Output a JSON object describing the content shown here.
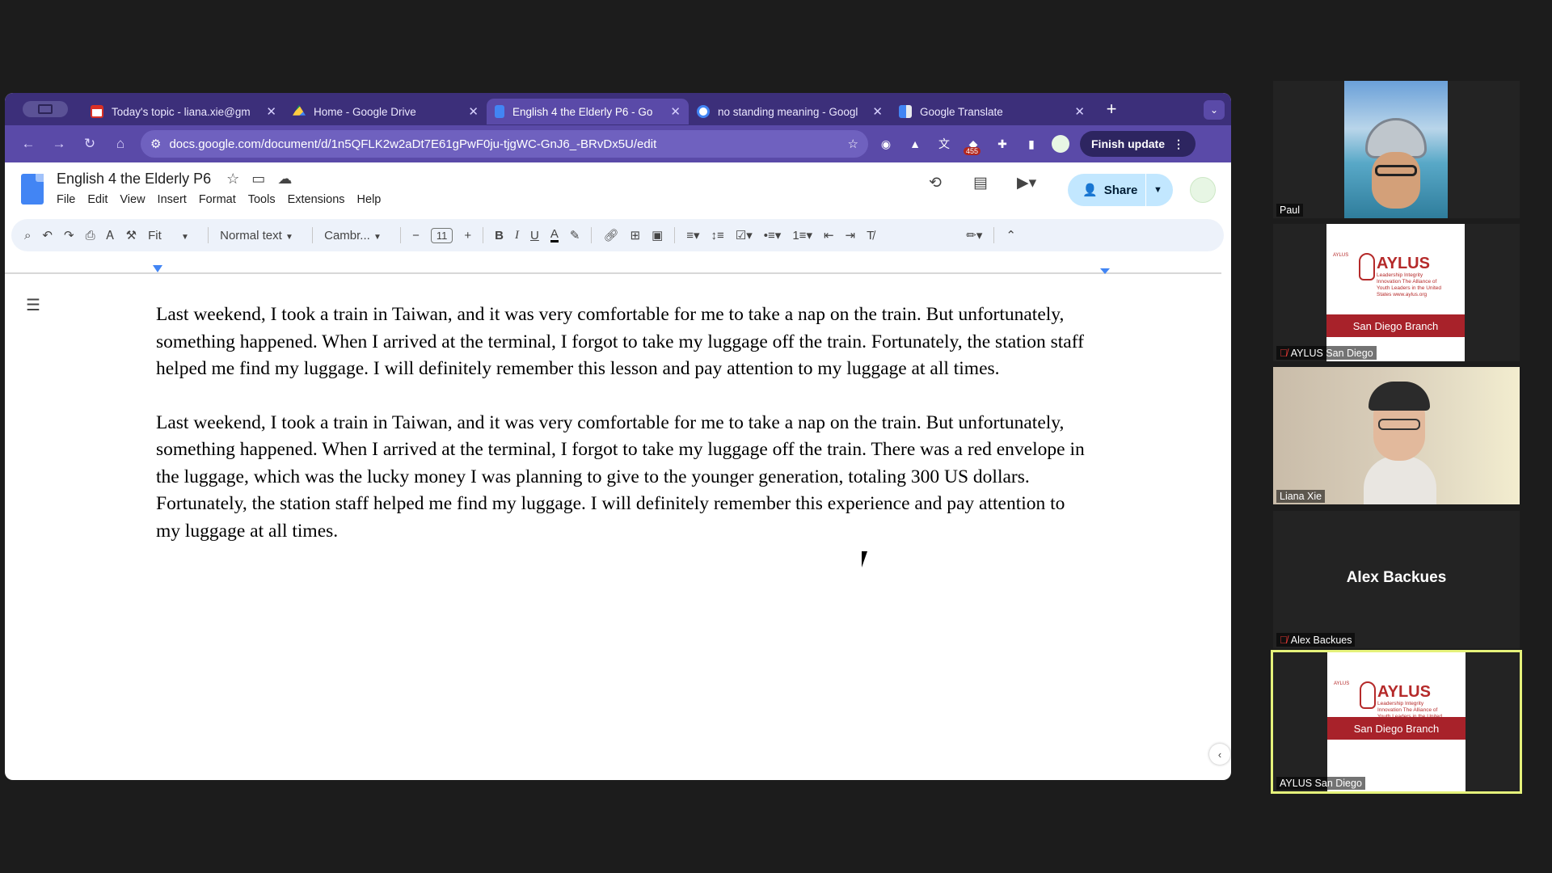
{
  "browser": {
    "tabs": [
      {
        "title": "Today's topic - liana.xie@gm",
        "icon": "gmail-icon",
        "active": false
      },
      {
        "title": "Home - Google Drive",
        "icon": "drive-icon",
        "active": false
      },
      {
        "title": "English 4 the Elderly P6 - Go",
        "icon": "docs-icon",
        "active": true
      },
      {
        "title": "no standing meaning - Googl",
        "icon": "google-icon",
        "active": false
      },
      {
        "title": "Google Translate",
        "icon": "translate-icon",
        "active": false
      }
    ],
    "url": "docs.google.com/document/d/1n5QFLK2w2aDt7E61gPwF0ju-tjgWC-GnJ6_-BRvDx5U/edit",
    "extension_badge": "455",
    "finish_update_label": "Finish update"
  },
  "docs": {
    "title": "English 4 the Elderly P6",
    "menu": [
      "File",
      "Edit",
      "View",
      "Insert",
      "Format",
      "Tools",
      "Extensions",
      "Help"
    ],
    "share_label": "Share",
    "toolbar": {
      "zoom": "Fit",
      "style": "Normal text",
      "font": "Cambr...",
      "font_size": "11"
    },
    "paragraphs": [
      "Last weekend, I took a train in Taiwan, and it was very comfortable for me to take a nap on the train. But unfortunately, something happened. When I arrived at the terminal, I forgot to take my luggage off the train. Fortunately, the station staff helped me find my luggage. I will definitely remember this lesson and pay attention to my luggage at all times.",
      "Last weekend, I took a train in Taiwan, and it was very comfortable for me to take a nap on the train. But unfortunately, something happened. When I arrived at the terminal, I forgot to take my luggage off the train. There was a red envelope in the luggage, which was the lucky money I was planning to give to the younger generation, totaling 300 US dollars. Fortunately, the station staff helped me find my luggage. I will definitely remember this experience and pay attention to my luggage at all times."
    ]
  },
  "meeting": {
    "participants": [
      {
        "name": "Paul",
        "muted": false,
        "type": "video"
      },
      {
        "name": "AYLUS San Diego",
        "muted": true,
        "type": "logo"
      },
      {
        "name": "Liana Xie",
        "muted": false,
        "type": "video"
      },
      {
        "name": "Alex Backues",
        "muted": true,
        "type": "name"
      },
      {
        "name": "AYLUS San Diego",
        "muted": false,
        "type": "logo",
        "speaking": true
      }
    ],
    "aylus_card": {
      "top": "AYLUS",
      "word": "AYLUS",
      "sub": "Leadership Integrity Innovation The Alliance of Youth Leaders in the United States www.aylus.org",
      "branch": "San Diego Branch"
    },
    "colors": {
      "speaking_border": "#e5f27a",
      "aylus_red": "#a8222a"
    }
  }
}
